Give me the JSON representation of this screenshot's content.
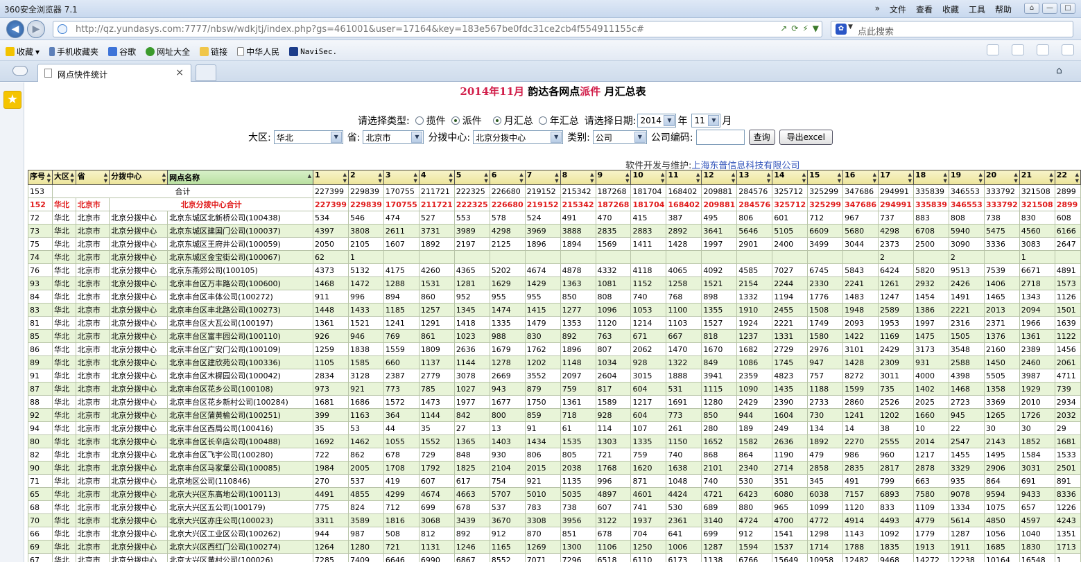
{
  "browser": {
    "app_title": "360安全浏览器 7.1",
    "menus": [
      "»",
      "文件",
      "查看",
      "收藏",
      "工具",
      "帮助"
    ],
    "url": "http://qz.yundasys.com:7777/nbsw/wdkjtj/index.php?gs=461001&user=17164&key=183e567be0fdc31ce2cb4f554911155c#",
    "search_placeholder": "点此搜索",
    "bookmarks": [
      "收藏",
      "手机收藏夹",
      "谷歌",
      "网址大全",
      "链接",
      "中华人民",
      "NaviSec."
    ],
    "tab_title": "网点快件统计",
    "tab_close": "×"
  },
  "colors": {
    "accent_red": "#d11f4a",
    "row_green": "#e8f4d8",
    "header_yellow": "#ece49a"
  },
  "page": {
    "title_year_month": "2014年11月",
    "title_mid": "韵达各网点",
    "title_type": "派件",
    "title_end": "月汇总表",
    "filter1": {
      "label_type": "请选择类型:",
      "opt_collect": "揽件",
      "opt_deliver": "派件",
      "opt_monthly": "月汇总",
      "opt_yearly": "年汇总",
      "label_date": "请选择日期:",
      "year": "2014",
      "year_unit": "年",
      "month": "11",
      "month_unit": "月"
    },
    "filter2": {
      "label_region": "大区:",
      "region": "华北",
      "label_province": "省:",
      "province": "北京市",
      "label_center": "分拨中心:",
      "center": "北京分拨中心",
      "label_category": "类别:",
      "category": "公司",
      "label_code": "公司编码:",
      "query_button": "查询",
      "export_button": "导出excel"
    },
    "credit_label": "软件开发与维护:",
    "credit_company": "上海东普信息科技有限公司"
  },
  "table": {
    "headers": [
      "序号",
      "大区",
      "省",
      "分拨中心",
      "网点名称",
      "1",
      "2",
      "3",
      "4",
      "5",
      "6",
      "7",
      "8",
      "9",
      "10",
      "11",
      "12",
      "13",
      "14",
      "15",
      "16",
      "17",
      "18",
      "19",
      "20",
      "21",
      "22"
    ],
    "total_row": {
      "id": "153",
      "label": "合计",
      "values": [
        "227399",
        "229839",
        "170755",
        "211721",
        "222325",
        "226680",
        "219152",
        "215342",
        "187268",
        "181704",
        "168402",
        "209881",
        "284576",
        "325712",
        "325299",
        "347686",
        "294991",
        "335839",
        "346553",
        "333792",
        "321508",
        "2899"
      ]
    },
    "sub_row": {
      "id": "152",
      "region": "华北",
      "province": "北京市",
      "label": "北京分拨中心合计",
      "values": [
        "227399",
        "229839",
        "170755",
        "211721",
        "222325",
        "226680",
        "219152",
        "215342",
        "187268",
        "181704",
        "168402",
        "209881",
        "284576",
        "325712",
        "325299",
        "347686",
        "294991",
        "335839",
        "346553",
        "333792",
        "321508",
        "2899"
      ]
    },
    "rows": [
      {
        "id": "72",
        "region": "华北",
        "province": "北京市",
        "center": "北京分拨中心",
        "name": "北京东城区北新桥公司(100438)",
        "values": [
          "534",
          "546",
          "474",
          "527",
          "553",
          "578",
          "524",
          "491",
          "470",
          "415",
          "387",
          "495",
          "806",
          "601",
          "712",
          "967",
          "737",
          "883",
          "808",
          "738",
          "830",
          "608"
        ]
      },
      {
        "id": "73",
        "region": "华北",
        "province": "北京市",
        "center": "北京分拨中心",
        "name": "北京东城区建国门公司(100037)",
        "values": [
          "4397",
          "3808",
          "2611",
          "3731",
          "3989",
          "4298",
          "3969",
          "3888",
          "2835",
          "2883",
          "2892",
          "3641",
          "5646",
          "5105",
          "6609",
          "5680",
          "4298",
          "6708",
          "5940",
          "5475",
          "4560",
          "6166"
        ]
      },
      {
        "id": "75",
        "region": "华北",
        "province": "北京市",
        "center": "北京分拨中心",
        "name": "北京东城区王府井公司(100059)",
        "values": [
          "2050",
          "2105",
          "1607",
          "1892",
          "2197",
          "2125",
          "1896",
          "1894",
          "1569",
          "1411",
          "1428",
          "1997",
          "2901",
          "2400",
          "3499",
          "3044",
          "2373",
          "2500",
          "3090",
          "3336",
          "3083",
          "2647"
        ]
      },
      {
        "id": "74",
        "region": "华北",
        "province": "北京市",
        "center": "北京分拨中心",
        "name": "北京东城区金宝街公司(100067)",
        "values": [
          "62",
          "1",
          "",
          "",
          "",
          "",
          "",
          "",
          "",
          "",
          "",
          "",
          "",
          "",
          "",
          "",
          "2",
          "",
          "2",
          "",
          "1",
          ""
        ]
      },
      {
        "id": "76",
        "region": "华北",
        "province": "北京市",
        "center": "北京分拨中心",
        "name": "北京东燕郊公司(100105)",
        "values": [
          "4373",
          "5132",
          "4175",
          "4260",
          "4365",
          "5202",
          "4674",
          "4878",
          "4332",
          "4118",
          "4065",
          "4092",
          "4585",
          "7027",
          "6745",
          "5843",
          "6424",
          "5820",
          "9513",
          "7539",
          "6671",
          "4891"
        ]
      },
      {
        "id": "93",
        "region": "华北",
        "province": "北京市",
        "center": "北京分拨中心",
        "name": "北京丰台区万丰路公司(100600)",
        "values": [
          "1468",
          "1472",
          "1288",
          "1531",
          "1281",
          "1629",
          "1429",
          "1363",
          "1081",
          "1152",
          "1258",
          "1521",
          "2154",
          "2244",
          "2330",
          "2241",
          "1261",
          "2932",
          "2426",
          "1406",
          "2718",
          "1573"
        ]
      },
      {
        "id": "84",
        "region": "华北",
        "province": "北京市",
        "center": "北京分拨中心",
        "name": "北京丰台区丰体公司(100272)",
        "values": [
          "911",
          "996",
          "894",
          "860",
          "952",
          "955",
          "955",
          "850",
          "808",
          "740",
          "768",
          "898",
          "1332",
          "1194",
          "1776",
          "1483",
          "1247",
          "1454",
          "1491",
          "1465",
          "1343",
          "1126"
        ]
      },
      {
        "id": "83",
        "region": "华北",
        "province": "北京市",
        "center": "北京分拨中心",
        "name": "北京丰台区丰北路公司(100273)",
        "values": [
          "1448",
          "1433",
          "1185",
          "1257",
          "1345",
          "1474",
          "1415",
          "1277",
          "1096",
          "1053",
          "1100",
          "1355",
          "1910",
          "2455",
          "1508",
          "1948",
          "2589",
          "1386",
          "2221",
          "2013",
          "2094",
          "1501"
        ]
      },
      {
        "id": "81",
        "region": "华北",
        "province": "北京市",
        "center": "北京分拨中心",
        "name": "北京丰台区大瓦公司(100197)",
        "values": [
          "1361",
          "1521",
          "1241",
          "1291",
          "1418",
          "1335",
          "1479",
          "1353",
          "1120",
          "1214",
          "1103",
          "1527",
          "1924",
          "2221",
          "1749",
          "2093",
          "1953",
          "1997",
          "2316",
          "2371",
          "1966",
          "1639"
        ]
      },
      {
        "id": "85",
        "region": "华北",
        "province": "北京市",
        "center": "北京分拨中心",
        "name": "北京丰台区富丰园公司(100110)",
        "values": [
          "926",
          "946",
          "769",
          "861",
          "1023",
          "988",
          "830",
          "892",
          "763",
          "671",
          "667",
          "818",
          "1237",
          "1331",
          "1580",
          "1422",
          "1169",
          "1475",
          "1505",
          "1376",
          "1361",
          "1122"
        ]
      },
      {
        "id": "86",
        "region": "华北",
        "province": "北京市",
        "center": "北京分拨中心",
        "name": "北京丰台区广安门公司(100109)",
        "values": [
          "1259",
          "1838",
          "1559",
          "1809",
          "2636",
          "1679",
          "1762",
          "1896",
          "807",
          "2062",
          "1470",
          "1670",
          "1682",
          "2729",
          "2976",
          "3101",
          "2429",
          "3173",
          "3548",
          "2160",
          "2389",
          "1456"
        ]
      },
      {
        "id": "89",
        "region": "华北",
        "province": "北京市",
        "center": "北京分拨中心",
        "name": "北京丰台区建欣苑公司(100336)",
        "values": [
          "1105",
          "1585",
          "660",
          "1137",
          "1144",
          "1278",
          "1202",
          "1148",
          "1034",
          "928",
          "1322",
          "849",
          "1086",
          "1745",
          "947",
          "1428",
          "2309",
          "931",
          "2588",
          "1450",
          "2460",
          "2061"
        ]
      },
      {
        "id": "91",
        "region": "华北",
        "province": "北京市",
        "center": "北京分拨中心",
        "name": "北京丰台区木樨园公司(100042)",
        "values": [
          "2834",
          "3128",
          "2387",
          "2779",
          "3078",
          "2669",
          "3552",
          "2097",
          "2604",
          "3015",
          "1888",
          "3941",
          "2359",
          "4823",
          "757",
          "8272",
          "3011",
          "4000",
          "4398",
          "5505",
          "3987",
          "4711"
        ]
      },
      {
        "id": "87",
        "region": "华北",
        "province": "北京市",
        "center": "北京分拨中心",
        "name": "北京丰台区花乡公司(100108)",
        "values": [
          "973",
          "921",
          "773",
          "785",
          "1027",
          "943",
          "879",
          "759",
          "817",
          "604",
          "531",
          "1115",
          "1090",
          "1435",
          "1188",
          "1599",
          "735",
          "1402",
          "1468",
          "1358",
          "1929",
          "739"
        ]
      },
      {
        "id": "88",
        "region": "华北",
        "province": "北京市",
        "center": "北京分拨中心",
        "name": "北京丰台区花乡新村公司(100284)",
        "values": [
          "1681",
          "1686",
          "1572",
          "1473",
          "1977",
          "1677",
          "1750",
          "1361",
          "1589",
          "1217",
          "1691",
          "1280",
          "2429",
          "2390",
          "2733",
          "2860",
          "2526",
          "2025",
          "2723",
          "3369",
          "2010",
          "2934"
        ]
      },
      {
        "id": "92",
        "region": "华北",
        "province": "北京市",
        "center": "北京分拨中心",
        "name": "北京丰台区蒲黄榆公司(100251)",
        "values": [
          "399",
          "1163",
          "364",
          "1144",
          "842",
          "800",
          "859",
          "718",
          "928",
          "604",
          "773",
          "850",
          "944",
          "1604",
          "730",
          "1241",
          "1202",
          "1660",
          "945",
          "1265",
          "1726",
          "2032"
        ]
      },
      {
        "id": "94",
        "region": "华北",
        "province": "北京市",
        "center": "北京分拨中心",
        "name": "北京丰台区西局公司(100416)",
        "values": [
          "35",
          "53",
          "44",
          "35",
          "27",
          "13",
          "91",
          "61",
          "114",
          "107",
          "261",
          "280",
          "189",
          "249",
          "134",
          "14",
          "38",
          "10",
          "22",
          "30",
          "30",
          "29"
        ]
      },
      {
        "id": "80",
        "region": "华北",
        "province": "北京市",
        "center": "北京分拨中心",
        "name": "北京丰台区长辛店公司(100488)",
        "values": [
          "1692",
          "1462",
          "1055",
          "1552",
          "1365",
          "1403",
          "1434",
          "1535",
          "1303",
          "1335",
          "1150",
          "1652",
          "1582",
          "2636",
          "1892",
          "2270",
          "2555",
          "2014",
          "2547",
          "2143",
          "1852",
          "1681"
        ]
      },
      {
        "id": "82",
        "region": "华北",
        "province": "北京市",
        "center": "北京分拨中心",
        "name": "北京丰台区飞宇公司(100280)",
        "values": [
          "722",
          "862",
          "678",
          "729",
          "848",
          "930",
          "806",
          "805",
          "721",
          "759",
          "740",
          "868",
          "864",
          "1190",
          "479",
          "986",
          "960",
          "1217",
          "1455",
          "1495",
          "1584",
          "1533"
        ]
      },
      {
        "id": "90",
        "region": "华北",
        "province": "北京市",
        "center": "北京分拨中心",
        "name": "北京丰台区马家堡公司(100085)",
        "values": [
          "1984",
          "2005",
          "1708",
          "1792",
          "1825",
          "2104",
          "2015",
          "2038",
          "1768",
          "1620",
          "1638",
          "2101",
          "2340",
          "2714",
          "2858",
          "2835",
          "2817",
          "2878",
          "3329",
          "2906",
          "3031",
          "2501"
        ]
      },
      {
        "id": "71",
        "region": "华北",
        "province": "北京市",
        "center": "北京分拨中心",
        "name": "北京地区公司(110846)",
        "values": [
          "270",
          "537",
          "419",
          "607",
          "617",
          "754",
          "921",
          "1135",
          "996",
          "871",
          "1048",
          "740",
          "530",
          "351",
          "345",
          "491",
          "799",
          "663",
          "935",
          "864",
          "691",
          "891"
        ]
      },
      {
        "id": "65",
        "region": "华北",
        "province": "北京市",
        "center": "北京分拨中心",
        "name": "北京大兴区东高地公司(100113)",
        "values": [
          "4491",
          "4855",
          "4299",
          "4674",
          "4663",
          "5707",
          "5010",
          "5035",
          "4897",
          "4601",
          "4424",
          "4721",
          "6423",
          "6080",
          "6038",
          "7157",
          "6893",
          "7580",
          "9078",
          "9594",
          "9433",
          "8336"
        ]
      },
      {
        "id": "68",
        "region": "华北",
        "province": "北京市",
        "center": "北京分拨中心",
        "name": "北京大兴区五公司(100179)",
        "values": [
          "775",
          "824",
          "712",
          "699",
          "678",
          "537",
          "783",
          "738",
          "607",
          "741",
          "530",
          "689",
          "880",
          "965",
          "1099",
          "1120",
          "833",
          "1109",
          "1334",
          "1075",
          "657",
          "1226"
        ]
      },
      {
        "id": "70",
        "region": "华北",
        "province": "北京市",
        "center": "北京分拨中心",
        "name": "北京大兴区亦庄公司(100023)",
        "values": [
          "3311",
          "3589",
          "1816",
          "3068",
          "3439",
          "3670",
          "3308",
          "3956",
          "3122",
          "1937",
          "2361",
          "3140",
          "4724",
          "4700",
          "4772",
          "4914",
          "4493",
          "4779",
          "5614",
          "4850",
          "4597",
          "4243"
        ]
      },
      {
        "id": "66",
        "region": "华北",
        "province": "北京市",
        "center": "北京分拨中心",
        "name": "北京大兴区工业区公司(100262)",
        "values": [
          "944",
          "987",
          "508",
          "812",
          "892",
          "912",
          "870",
          "851",
          "678",
          "704",
          "641",
          "699",
          "912",
          "1541",
          "1298",
          "1143",
          "1092",
          "1779",
          "1287",
          "1056",
          "1040",
          "1351"
        ]
      },
      {
        "id": "69",
        "region": "华北",
        "province": "北京市",
        "center": "北京分拨中心",
        "name": "北京大兴区西红门公司(100274)",
        "values": [
          "1264",
          "1280",
          "721",
          "1131",
          "1246",
          "1165",
          "1269",
          "1300",
          "1106",
          "1250",
          "1006",
          "1287",
          "1594",
          "1537",
          "1714",
          "1788",
          "1835",
          "1913",
          "1911",
          "1685",
          "1830",
          "1713"
        ]
      },
      {
        "id": "67",
        "region": "华北",
        "province": "北京市",
        "center": "北京分拨中心",
        "name": "北京大兴区黄村公司(100026)",
        "values": [
          "7285",
          "7409",
          "6646",
          "6990",
          "6867",
          "8552",
          "7071",
          "7296",
          "6518",
          "6110",
          "6173",
          "1138",
          "6766",
          "15649",
          "10958",
          "12482",
          "9468",
          "14272",
          "12238",
          "10164",
          "16548",
          "1"
        ]
      }
    ]
  }
}
